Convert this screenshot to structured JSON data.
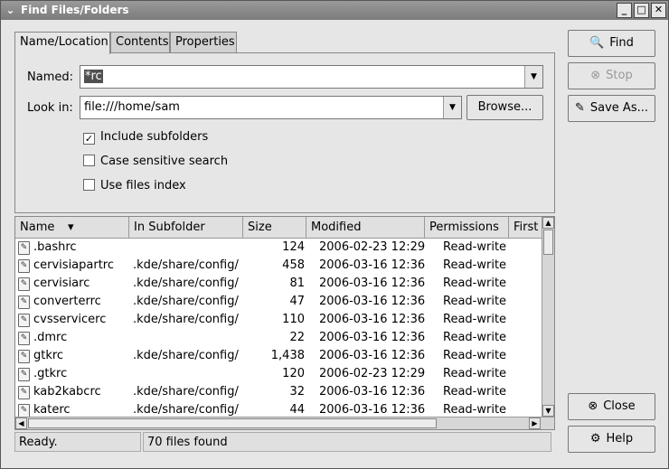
{
  "window": {
    "title": "Find Files/Folders",
    "menu_icon": "chevron-down-icon",
    "controls": {
      "minimize": "_",
      "maximize": "□",
      "close": "✕"
    }
  },
  "tabs": [
    {
      "label": "Name/Location",
      "active": true
    },
    {
      "label": "Contents",
      "active": false
    },
    {
      "label": "Properties",
      "active": false
    }
  ],
  "form": {
    "named_label": "Named:",
    "named_value": "*rc",
    "lookin_label": "Look in:",
    "lookin_value": "file:///home/sam",
    "browse_label": "Browse...",
    "include_subfolders": {
      "label": "Include subfolders",
      "checked": true
    },
    "case_sensitive": {
      "label": "Case sensitive search",
      "checked": false
    },
    "use_index": {
      "label": "Use files index",
      "checked": false
    }
  },
  "buttons": {
    "find": "Find",
    "stop": "Stop",
    "save_as": "Save As...",
    "close": "Close",
    "help": "Help"
  },
  "results": {
    "columns": [
      "Name",
      "In Subfolder",
      "Size",
      "Modified",
      "Permissions",
      "First"
    ],
    "sort_indicator": "▾",
    "rows": [
      {
        "name": ".bashrc",
        "folder": "",
        "size": "124",
        "modified": "2006-02-23 12:29",
        "perm": "Read-write"
      },
      {
        "name": "cervisiapartrc",
        "folder": ".kde/share/config/",
        "size": "458",
        "modified": "2006-03-16 12:36",
        "perm": "Read-write"
      },
      {
        "name": "cervisiarc",
        "folder": ".kde/share/config/",
        "size": "81",
        "modified": "2006-03-16 12:36",
        "perm": "Read-write"
      },
      {
        "name": "converterrc",
        "folder": ".kde/share/config/",
        "size": "47",
        "modified": "2006-03-16 12:36",
        "perm": "Read-write"
      },
      {
        "name": "cvsservicerc",
        "folder": ".kde/share/config/",
        "size": "110",
        "modified": "2006-03-16 12:36",
        "perm": "Read-write"
      },
      {
        "name": ".dmrc",
        "folder": "",
        "size": "22",
        "modified": "2006-03-16 12:36",
        "perm": "Read-write"
      },
      {
        "name": "gtkrc",
        "folder": ".kde/share/config/",
        "size": "1,438",
        "modified": "2006-03-16 12:36",
        "perm": "Read-write"
      },
      {
        "name": ".gtkrc",
        "folder": "",
        "size": "120",
        "modified": "2006-02-23 12:29",
        "perm": "Read-write"
      },
      {
        "name": "kab2kabcrc",
        "folder": ".kde/share/config/",
        "size": "32",
        "modified": "2006-03-16 12:36",
        "perm": "Read-write"
      },
      {
        "name": "katerc",
        "folder": ".kde/share/config/",
        "size": "44",
        "modified": "2006-03-16 12:36",
        "perm": "Read-write"
      }
    ]
  },
  "status": {
    "left": "Ready.",
    "right": "70 files found"
  }
}
